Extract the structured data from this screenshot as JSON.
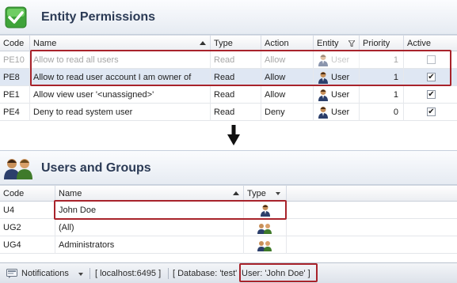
{
  "permissions_panel": {
    "title": "Entity Permissions",
    "columns": {
      "code": "Code",
      "name": "Name",
      "type": "Type",
      "action": "Action",
      "entity": "Entity",
      "priority": "Priority",
      "active": "Active"
    },
    "rows": [
      {
        "code": "PE10",
        "name": "Allow to read all users",
        "type": "Read",
        "action": "Allow",
        "entity": "User",
        "priority": "1",
        "active": false,
        "disabled": true
      },
      {
        "code": "PE8",
        "name": "Allow to read user account I am owner of",
        "type": "Read",
        "action": "Allow",
        "entity": "User",
        "priority": "1",
        "active": true,
        "selected": true
      },
      {
        "code": "PE1",
        "name": "Allow view user '<unassigned>'",
        "type": "Read",
        "action": "Allow",
        "entity": "User",
        "priority": "1",
        "active": true
      },
      {
        "code": "PE4",
        "name": "Deny to read system user",
        "type": "Read",
        "action": "Deny",
        "entity": "User",
        "priority": "0",
        "active": true
      }
    ]
  },
  "users_panel": {
    "title": "Users and Groups",
    "columns": {
      "code": "Code",
      "name": "Name",
      "type": "Type"
    },
    "rows": [
      {
        "code": "U4",
        "name": "John  Doe",
        "kind": "user"
      },
      {
        "code": "UG2",
        "name": "(All)",
        "kind": "group"
      },
      {
        "code": "UG4",
        "name": "Administrators",
        "kind": "group"
      }
    ]
  },
  "status_bar": {
    "notifications": "Notifications",
    "server": "[ localhost:6495 ]",
    "database": "[ Database: 'test'",
    "user": "User: 'John  Doe' ]"
  },
  "colors": {
    "highlight_border": "#a8232b",
    "selected_row": "#dfe7f3",
    "title_text": "#2b3a55"
  }
}
